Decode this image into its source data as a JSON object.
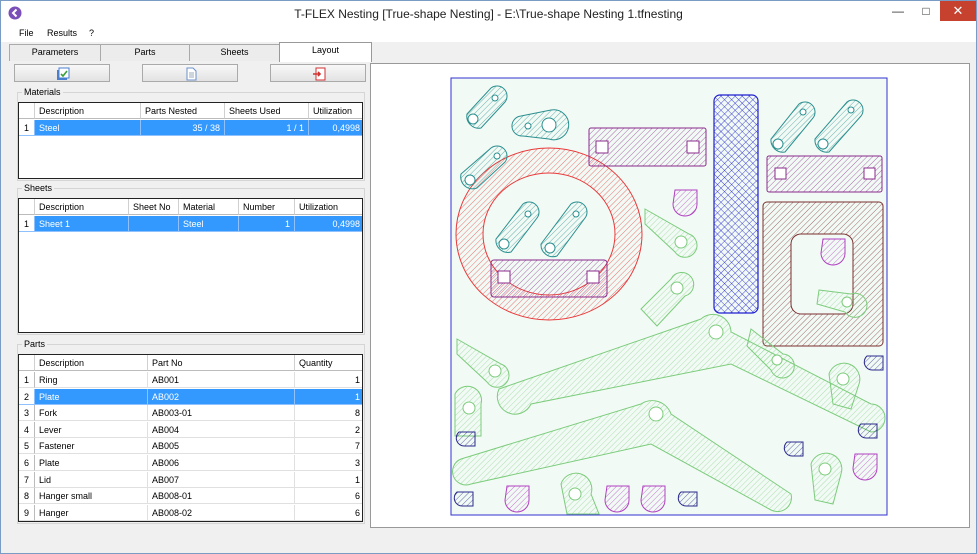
{
  "window": {
    "title": "T-FLEX Nesting [True-shape Nesting] - E:\\True-shape Nesting 1.tfnesting"
  },
  "menu": [
    "File",
    "Results",
    "?"
  ],
  "tabs": [
    "Parameters",
    "Parts",
    "Sheets",
    "Layout"
  ],
  "active_tab": "Layout",
  "toolbar": {
    "icons": [
      "export-icon",
      "document-icon",
      "exit-icon"
    ]
  },
  "materials": {
    "legend": "Materials",
    "columns": [
      "Description",
      "Parts Nested",
      "Sheets Used",
      "Utilization"
    ],
    "rows": [
      {
        "n": "1",
        "description": "Steel",
        "parts_nested": "35 / 38",
        "sheets_used": "1 / 1",
        "utilization": "0,4998"
      }
    ]
  },
  "sheets": {
    "legend": "Sheets",
    "columns": [
      "Description",
      "Sheet No",
      "Material",
      "Number",
      "Utilization"
    ],
    "rows": [
      {
        "n": "1",
        "description": "Sheet 1",
        "sheet_no": "",
        "material": "Steel",
        "number": "1",
        "utilization": "0,4998"
      }
    ]
  },
  "parts": {
    "legend": "Parts",
    "columns": [
      "Description",
      "Part No",
      "Quantity"
    ],
    "rows": [
      {
        "n": "1",
        "description": "Ring",
        "part_no": "AB001",
        "quantity": "1"
      },
      {
        "n": "2",
        "description": "Plate",
        "part_no": "AB002",
        "quantity": "1"
      },
      {
        "n": "3",
        "description": "Fork",
        "part_no": "AB003-01",
        "quantity": "8"
      },
      {
        "n": "4",
        "description": "Lever",
        "part_no": "AB004",
        "quantity": "2"
      },
      {
        "n": "5",
        "description": "Fastener",
        "part_no": "AB005",
        "quantity": "7"
      },
      {
        "n": "6",
        "description": "Plate",
        "part_no": "AB006",
        "quantity": "3"
      },
      {
        "n": "7",
        "description": "Lid",
        "part_no": "AB007",
        "quantity": "1"
      },
      {
        "n": "8",
        "description": "Hanger small",
        "part_no": "AB008-01",
        "quantity": "6"
      },
      {
        "n": "9",
        "description": "Hanger",
        "part_no": "AB008-02",
        "quantity": "6"
      }
    ]
  },
  "colors": {
    "selection": "#3399ff",
    "red": "#e8393a",
    "teal": "#2a8f8f",
    "purple": "#8b2b8b",
    "blue": "#1f1fd0",
    "brown": "#7a2e2e",
    "green": "#7ccc7c",
    "magenta": "#b040c0",
    "navy": "#2a2a8a"
  }
}
